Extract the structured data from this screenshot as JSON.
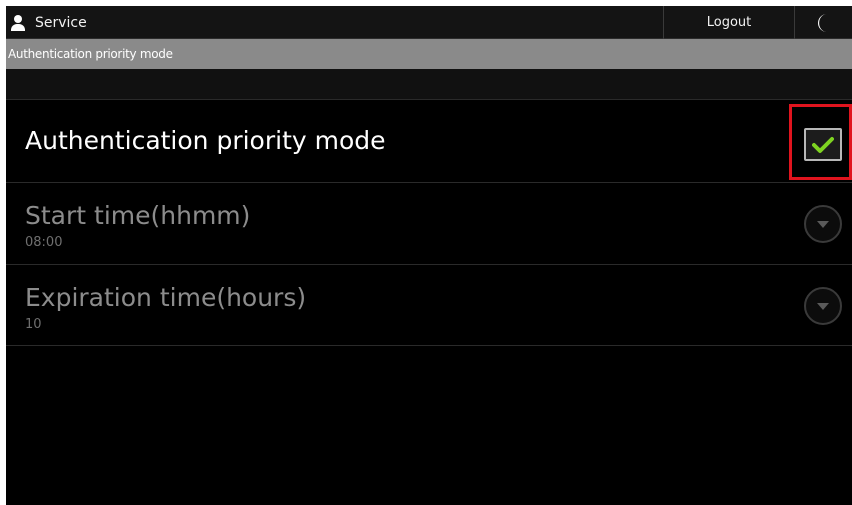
{
  "header": {
    "user_label": "Service",
    "logout_label": "Logout"
  },
  "title_bar": {
    "title": "Authentication priority mode"
  },
  "settings": {
    "auth_priority": {
      "label": "Authentication priority mode",
      "checked": true
    },
    "start_time": {
      "label": "Start time(hhmm)",
      "value": "08:00"
    },
    "expiration_time": {
      "label": "Expiration time(hours)",
      "value": "10"
    }
  },
  "colors": {
    "check_accent": "#7ed321",
    "highlight_border": "#e0141e",
    "title_bar_bg": "#8a8a8a"
  },
  "icons": {
    "user": "user-icon",
    "sleep": "moon-icon",
    "check": "checkmark-icon",
    "dropdown": "chevron-down-icon"
  }
}
